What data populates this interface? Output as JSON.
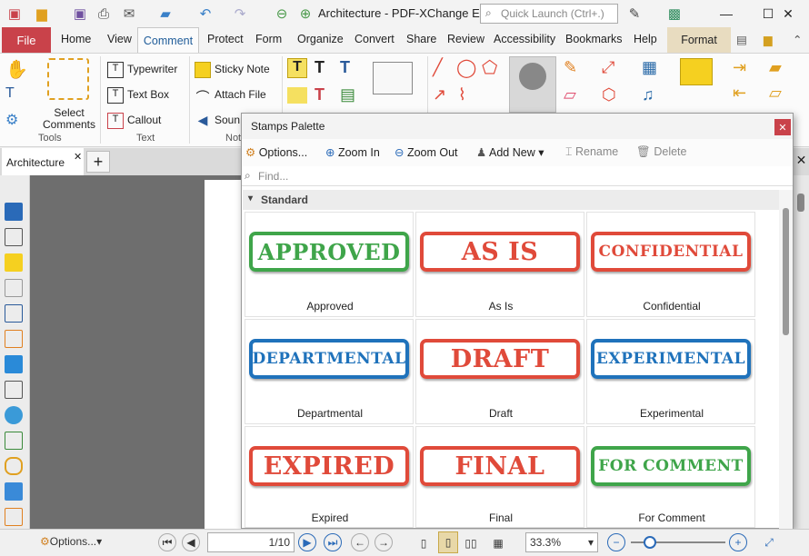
{
  "app": {
    "title": "Architecture - PDF-XChange Ed...",
    "quick_launch": "Quick Launch (Ctrl+.)"
  },
  "menu_tabs": {
    "file": "File",
    "home": "Home",
    "view": "View",
    "comment": "Comment",
    "protect": "Protect",
    "form": "Form",
    "organize": "Organize",
    "convert": "Convert",
    "share": "Share",
    "review": "Review",
    "accessibility": "Accessibility",
    "bookmarks": "Bookmarks",
    "help": "Help",
    "format": "Format"
  },
  "ribbon": {
    "select_comments": "Select Comments",
    "typewriter": "Typewriter",
    "text_box": "Text Box",
    "callout": "Callout",
    "sticky_note": "Sticky Note",
    "attach_file": "Attach File",
    "sound": "Soun",
    "groups": {
      "tools": "Tools",
      "text": "Text",
      "note": "Not"
    }
  },
  "doc_tab": {
    "name": "Architecture"
  },
  "stamps_palette": {
    "title": "Stamps Palette",
    "toolbar": {
      "options": "Options...",
      "zoom_in": "Zoom In",
      "zoom_out": "Zoom Out",
      "add_new": "Add New",
      "rename": "Rename",
      "delete": "Delete"
    },
    "find_placeholder": "Find...",
    "section": "Standard",
    "stamps": [
      {
        "text": "APPROVED",
        "label": "Approved",
        "color": "#3fa54a"
      },
      {
        "text": "AS IS",
        "label": "As Is",
        "color": "#e04a3a"
      },
      {
        "text": "CONFIDENTIAL",
        "label": "Confidential",
        "color": "#e04a3a"
      },
      {
        "text": "DEPARTMENTAL",
        "label": "Departmental",
        "color": "#1f72bb"
      },
      {
        "text": "DRAFT",
        "label": "Draft",
        "color": "#e04a3a"
      },
      {
        "text": "EXPERIMENTAL",
        "label": "Experimental",
        "color": "#1f72bb"
      },
      {
        "text": "EXPIRED",
        "label": "Expired",
        "color": "#e04a3a"
      },
      {
        "text": "FINAL",
        "label": "Final",
        "color": "#e04a3a"
      },
      {
        "text": "FOR COMMENT",
        "label": "For Comment",
        "color": "#3fa54a"
      }
    ]
  },
  "status": {
    "options": "Options...",
    "page_current": "1",
    "page_total": "/10",
    "zoom": "33.3%"
  },
  "colors": {
    "file_tab": "#c9424a",
    "comment_tab_text": "#1f5c99",
    "format_tab": "#e8dcc0",
    "doc_area": "#6e6e6e"
  }
}
